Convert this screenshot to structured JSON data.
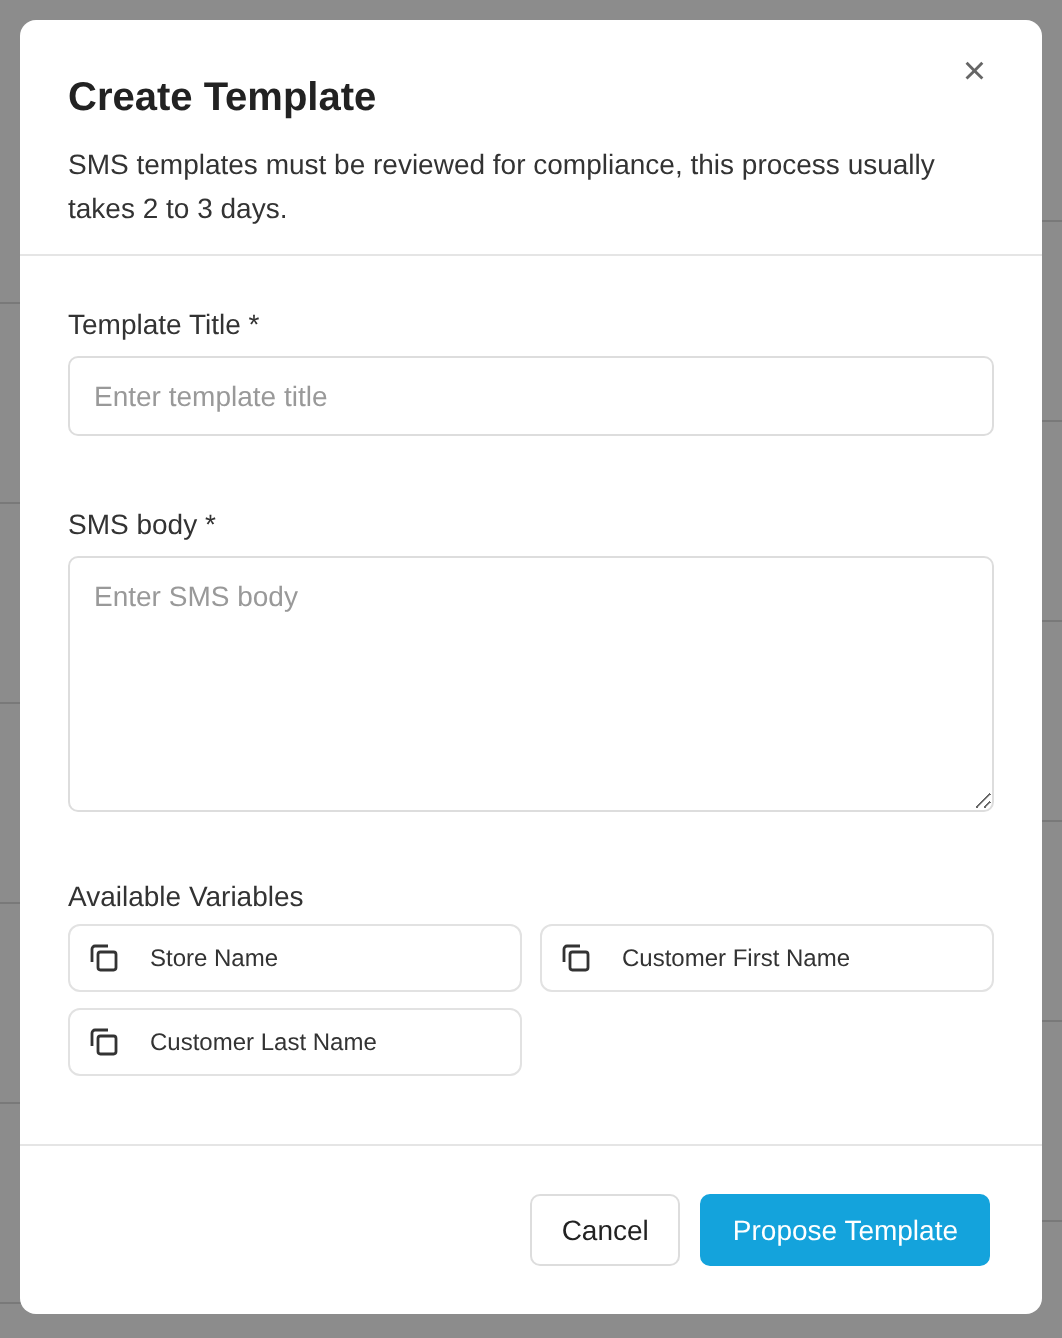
{
  "dialog": {
    "title": "Create Template",
    "close": "×",
    "description": "SMS templates must be reviewed for compliance, this process usually takes 2 to 3 days.",
    "fields": [
      {
        "kind": "input",
        "label": "Template Title *",
        "placeholder": "Enter template title"
      },
      {
        "kind": "textarea",
        "label": "SMS body *",
        "placeholder": "Enter SMS body"
      }
    ],
    "variables_label": "Available Variables",
    "variables": [
      "Store Name",
      "Customer First Name",
      "Customer Last Name"
    ],
    "buttons": [
      {
        "kind": "secondary",
        "label": "Cancel"
      },
      {
        "kind": "primary",
        "label": "Propose Template"
      }
    ]
  }
}
